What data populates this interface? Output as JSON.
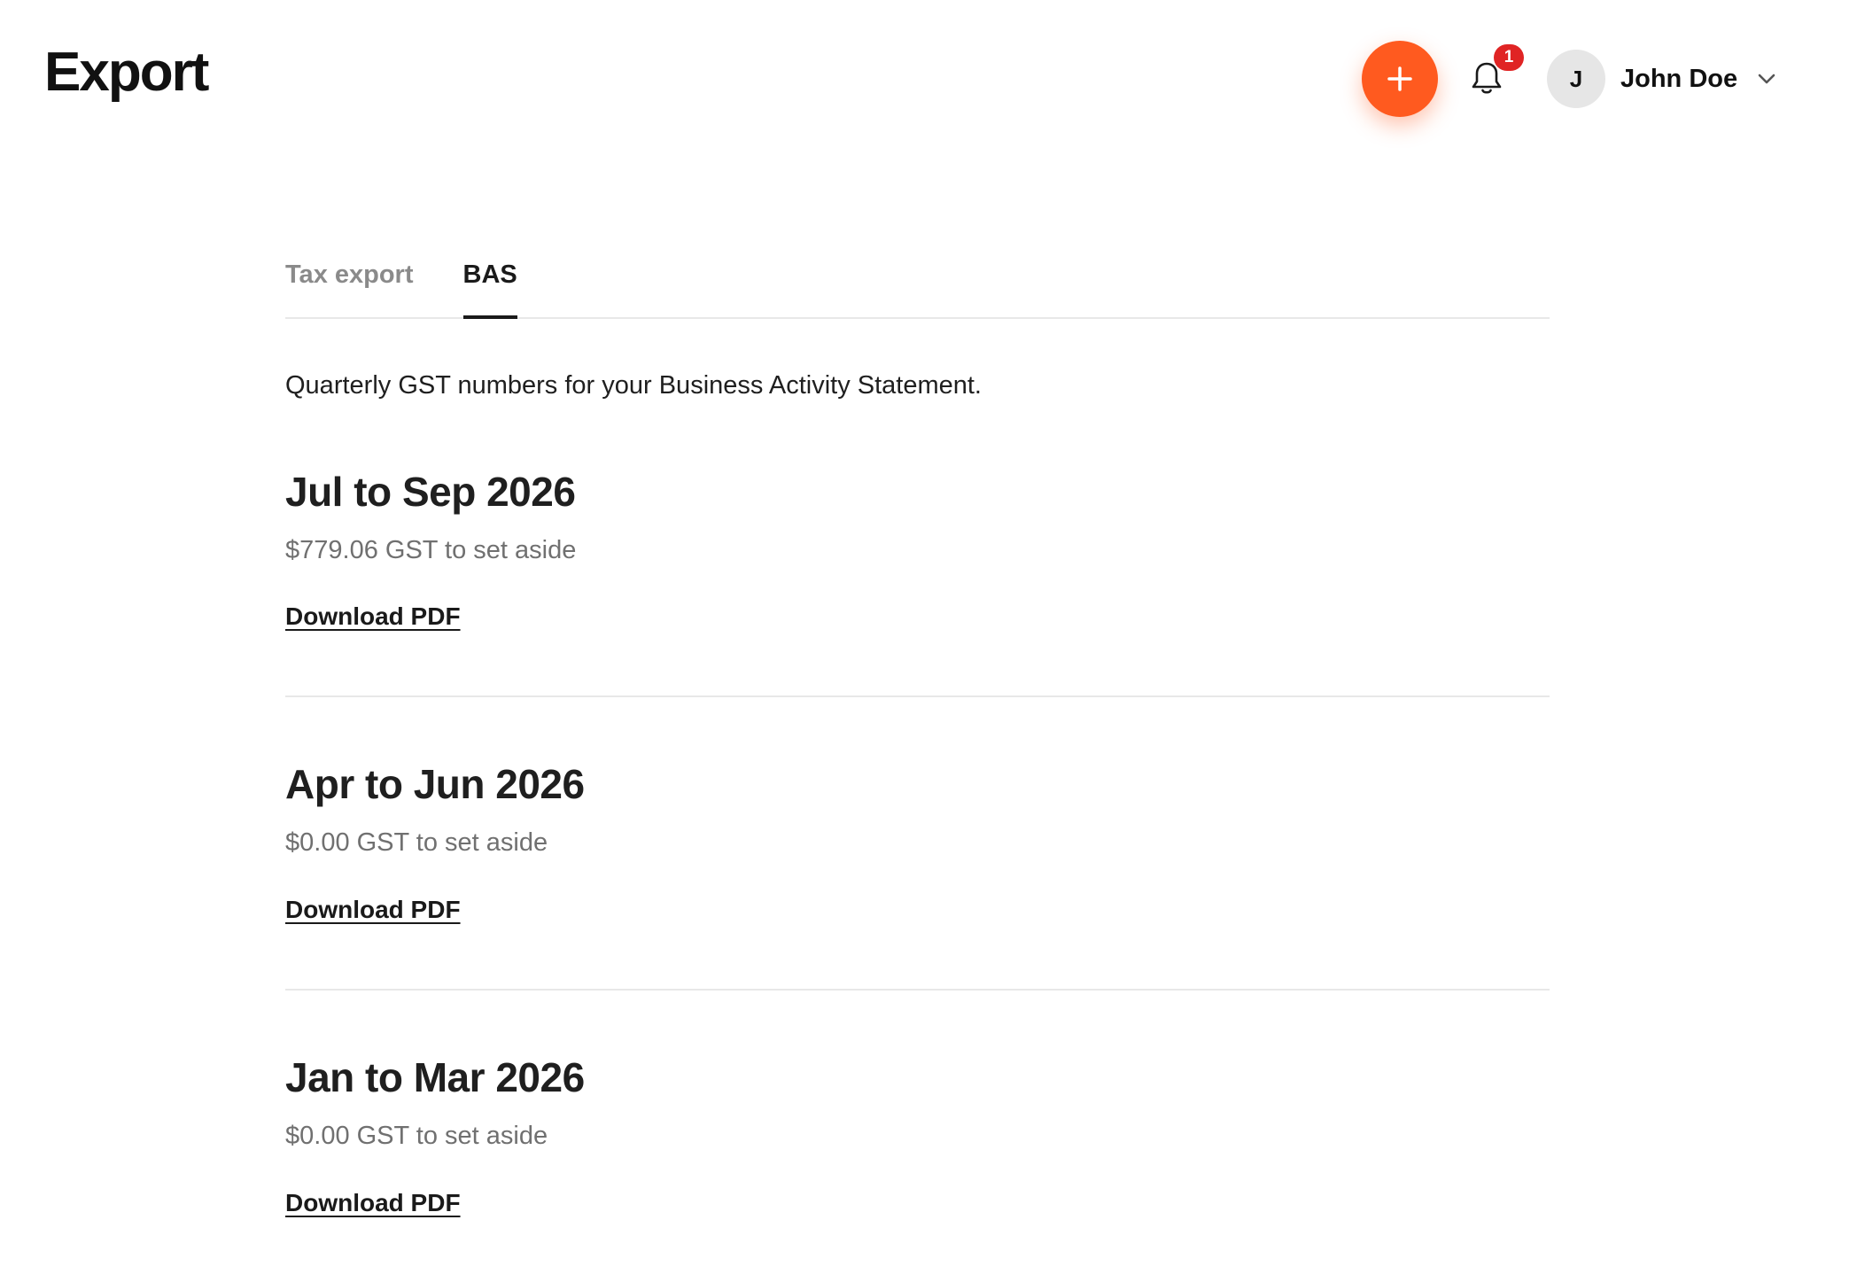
{
  "header": {
    "title": "Export",
    "notifications_count": "1",
    "user": {
      "initial": "J",
      "name": "John Doe"
    },
    "icons": {
      "add": "plus-icon",
      "notifications": "bell-icon",
      "menu": "chevron-down-icon"
    }
  },
  "tabs": [
    {
      "label": "Tax export",
      "active": false
    },
    {
      "label": "BAS",
      "active": true
    }
  ],
  "intro": "Quarterly GST numbers for your Business Activity Statement.",
  "periods": [
    {
      "title": "Jul to Sep 2026",
      "amount": "$779.06 GST to set aside",
      "link": "Download PDF"
    },
    {
      "title": "Apr to Jun 2026",
      "amount": "$0.00 GST to set aside",
      "link": "Download PDF"
    },
    {
      "title": "Jan to Mar 2026",
      "amount": "$0.00 GST to set aside",
      "link": "Download PDF"
    }
  ],
  "colors": {
    "accent": "#ff5a1f",
    "badge": "#e02424",
    "divider": "#e8e8e8"
  }
}
